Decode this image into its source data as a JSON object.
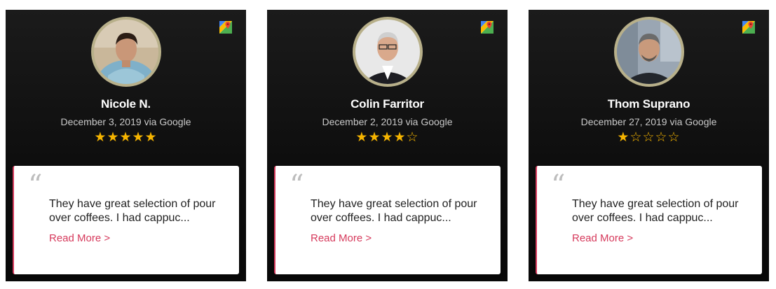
{
  "colors": {
    "accent": "#d63a5c",
    "star": "#f5b400",
    "card_bg": "#111111",
    "ring": "#b8b08a"
  },
  "reviews": [
    {
      "name": "Nicole N.",
      "date": "December 3, 2019",
      "via": "via Google",
      "rating": 5,
      "stars": "★★★★★",
      "text": "They have great selection of pour over coffees. I had cappuc...",
      "read_more": "Read More >",
      "source_icon": "google-maps-icon"
    },
    {
      "name": "Colin Farritor",
      "date": "December 2, 2019",
      "via": "via Google",
      "rating": 4,
      "stars": "★★★★☆",
      "text": "They have great selection of pour over coffees. I had cappuc...",
      "read_more": "Read More >",
      "source_icon": "google-maps-icon"
    },
    {
      "name": "Thom Suprano",
      "date": "December 27, 2019",
      "via": "via Google",
      "rating": 1,
      "stars": "★☆☆☆☆",
      "text": "They have great selection of pour over coffees. I had cappuc...",
      "read_more": "Read More >",
      "source_icon": "google-maps-icon"
    }
  ]
}
